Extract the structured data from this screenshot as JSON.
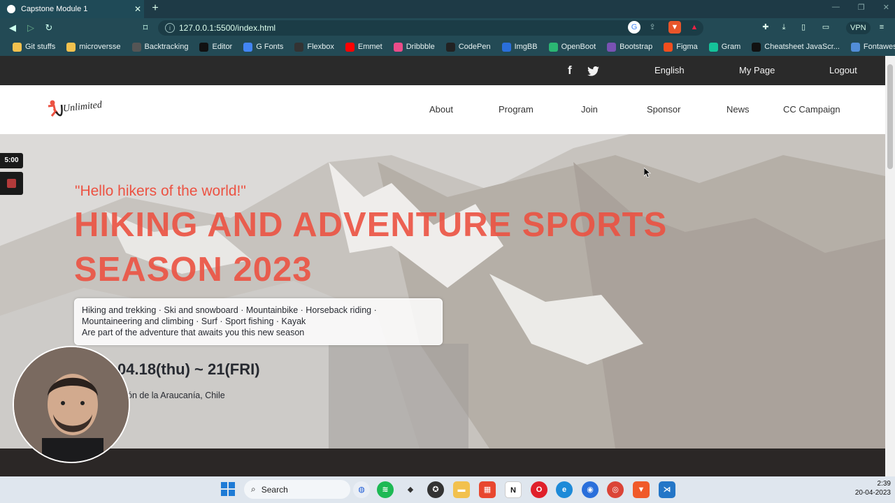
{
  "browser": {
    "tab_title": "Capstone Module 1",
    "tab_close": "✕",
    "new_tab": "+",
    "url": "127.0.0.1:5500/index.html",
    "vpn_label": "VPN",
    "window_controls": [
      "—",
      "❐",
      "✕"
    ],
    "bookmarks": [
      {
        "label": "Git stuffs",
        "icon": "folder-icon",
        "color": "#f2c14e"
      },
      {
        "label": "microversse",
        "icon": "folder-icon",
        "color": "#f2c14e"
      },
      {
        "label": "Backtracking",
        "icon": "bookmark-icon",
        "color": "#555555"
      },
      {
        "label": "Editor",
        "icon": "jc-icon",
        "color": "#111111"
      },
      {
        "label": "G Fonts",
        "icon": "gfonts-icon",
        "color": "#4285f4"
      },
      {
        "label": "Flexbox",
        "icon": "flexbox-icon",
        "color": "#333333"
      },
      {
        "label": "Emmet",
        "icon": "youtube-icon",
        "color": "#ff0000"
      },
      {
        "label": "Dribbble",
        "icon": "dribbble-icon",
        "color": "#ea4c89"
      },
      {
        "label": "CodePen",
        "icon": "codepen-icon",
        "color": "#222222"
      },
      {
        "label": "ImgBB",
        "icon": "imgbb-icon",
        "color": "#2a6fdb"
      },
      {
        "label": "OpenBoot",
        "icon": "openboot-icon",
        "color": "#2bb673"
      },
      {
        "label": "Bootstrap",
        "icon": "bootstrap-icon",
        "color": "#7952b3"
      },
      {
        "label": "Figma",
        "icon": "figma-icon",
        "color": "#f24e1e"
      },
      {
        "label": "Gram",
        "icon": "grammarly-icon",
        "color": "#15c39a"
      },
      {
        "label": "Cheatsheet JavaScr...",
        "icon": "github-icon",
        "color": "#111111"
      },
      {
        "label": "Fontawesome",
        "icon": "fontawesome-icon",
        "color": "#528dd7"
      }
    ]
  },
  "topbar": {
    "facebook_icon": "f",
    "twitter_icon": "🐦",
    "language": "English",
    "mypage": "My Page",
    "logout": "Logout"
  },
  "nav": {
    "logo_text": "Unlimited",
    "links": [
      "About",
      "Program",
      "Join",
      "Sponsor",
      "News",
      "CC Campaign"
    ]
  },
  "hero": {
    "greeting": "\"Hello hikers of the world!\"",
    "headline_line1": "HIKING AND ADVENTURE SPORTS",
    "headline_line2": "SEASON 2023",
    "info_line1": "Hiking and trekking · Ski and snowboard · Mountainbike · Horseback riding ·",
    "info_line2": "Mountaineering and climbing · Surf · Sport fishing · Kayak",
    "info_line3": "Are part of the adventure that awaits you this new season",
    "date": "04.18(thu) ~ 21(FRI)",
    "venue": "ón de la Araucanía, Chile"
  },
  "overlay": {
    "timer": "5:00"
  },
  "taskbar": {
    "search": "Search",
    "time": "2:39",
    "date": "20-04-2023"
  },
  "colors": {
    "accent": "#ec5242",
    "topstrip": "#2a2a2a",
    "text_dark": "#272a31"
  }
}
